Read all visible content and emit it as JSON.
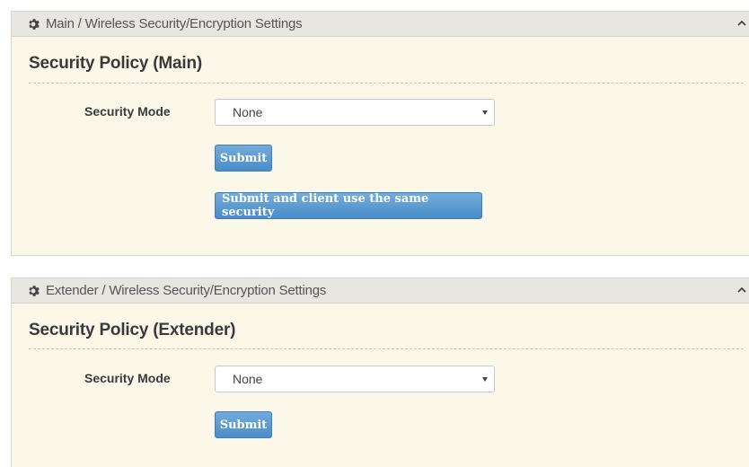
{
  "panels": [
    {
      "header_title": "Main / Wireless Security/Encryption Settings",
      "section_title": "Security Policy (Main)",
      "security_mode_label": "Security Mode",
      "security_mode_value": "None",
      "submit_label": "Submit",
      "submit_client_label": "Submit and client use the same security",
      "icons": {
        "header": "gear-icon",
        "collapse": "chevron-up-icon",
        "select": "caret-down-icon"
      }
    },
    {
      "header_title": "Extender / Wireless Security/Encryption Settings",
      "section_title": "Security Policy (Extender)",
      "security_mode_label": "Security Mode",
      "security_mode_value": "None",
      "submit_label": "Submit",
      "icons": {
        "header": "gear-icon",
        "collapse": "chevron-up-icon",
        "select": "caret-down-icon"
      }
    }
  ],
  "colors": {
    "panel_bg": "#fcf8e9",
    "header_bg": "#e8e6e1",
    "button_bg": "#4a8cc8",
    "text_dark": "#3a3a3a"
  }
}
